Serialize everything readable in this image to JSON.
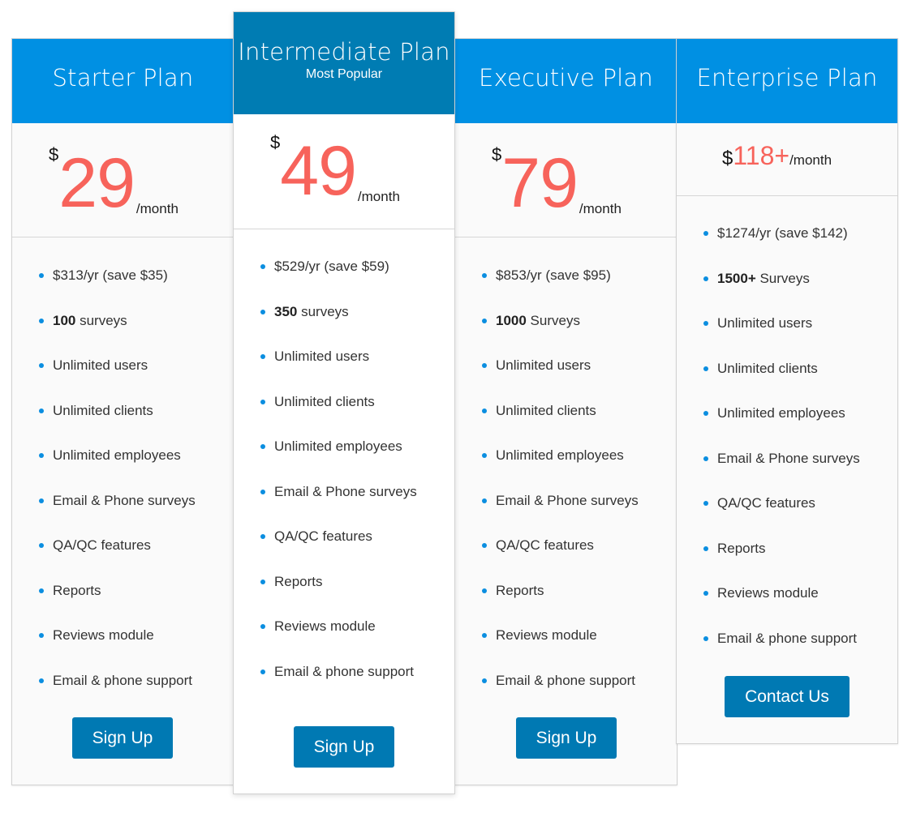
{
  "colors": {
    "header_default": "#0090e3",
    "header_popular": "#007cb3",
    "price_accent": "#f7635b",
    "button": "#0079b3",
    "bullet": "#0b8ee0"
  },
  "plans": [
    {
      "id": "starter",
      "title": "Starter Plan",
      "subtitle": "",
      "currency": "$",
      "amount": "29",
      "period": "/month",
      "features": [
        {
          "bold": "",
          "text": "$313/yr (save $35)"
        },
        {
          "bold": "100",
          "text": " surveys"
        },
        {
          "bold": "",
          "text": "Unlimited users"
        },
        {
          "bold": "",
          "text": "Unlimited clients"
        },
        {
          "bold": "",
          "text": "Unlimited employees"
        },
        {
          "bold": "",
          "text": "Email & Phone surveys"
        },
        {
          "bold": "",
          "text": "QA/QC features"
        },
        {
          "bold": "",
          "text": "Reports"
        },
        {
          "bold": "",
          "text": "Reviews module"
        },
        {
          "bold": "",
          "text": "Email & phone support"
        }
      ],
      "button_label": "Sign Up"
    },
    {
      "id": "intermediate",
      "title": "Intermediate Plan",
      "subtitle": "Most Popular",
      "currency": "$",
      "amount": "49",
      "period": "/month",
      "features": [
        {
          "bold": "",
          "text": "$529/yr (save $59)"
        },
        {
          "bold": "350",
          "text": " surveys"
        },
        {
          "bold": "",
          "text": "Unlimited users"
        },
        {
          "bold": "",
          "text": "Unlimited clients"
        },
        {
          "bold": "",
          "text": "Unlimited employees"
        },
        {
          "bold": "",
          "text": "Email & Phone surveys"
        },
        {
          "bold": "",
          "text": "QA/QC features"
        },
        {
          "bold": "",
          "text": "Reports"
        },
        {
          "bold": "",
          "text": "Reviews module"
        },
        {
          "bold": "",
          "text": "Email & phone support"
        }
      ],
      "button_label": "Sign Up"
    },
    {
      "id": "executive",
      "title": "Executive Plan",
      "subtitle": "",
      "currency": "$",
      "amount": "79",
      "period": "/month",
      "features": [
        {
          "bold": "",
          "text": "$853/yr (save $95)"
        },
        {
          "bold": "1000",
          "text": " Surveys"
        },
        {
          "bold": "",
          "text": "Unlimited users"
        },
        {
          "bold": "",
          "text": "Unlimited clients"
        },
        {
          "bold": "",
          "text": "Unlimited employees"
        },
        {
          "bold": "",
          "text": "Email & Phone surveys"
        },
        {
          "bold": "",
          "text": "QA/QC features"
        },
        {
          "bold": "",
          "text": "Reports"
        },
        {
          "bold": "",
          "text": "Reviews module"
        },
        {
          "bold": "",
          "text": "Email & phone support"
        }
      ],
      "button_label": "Sign Up"
    },
    {
      "id": "enterprise",
      "title": "Enterprise Plan",
      "subtitle": "",
      "currency": "$",
      "amount": "118+",
      "period": "/month",
      "features": [
        {
          "bold": "",
          "text": "$1274/yr (save $142)"
        },
        {
          "bold": "1500+",
          "text": " Surveys"
        },
        {
          "bold": "",
          "text": "Unlimited users"
        },
        {
          "bold": "",
          "text": "Unlimited clients"
        },
        {
          "bold": "",
          "text": "Unlimited employees"
        },
        {
          "bold": "",
          "text": "Email & Phone surveys"
        },
        {
          "bold": "",
          "text": "QA/QC features"
        },
        {
          "bold": "",
          "text": "Reports"
        },
        {
          "bold": "",
          "text": "Reviews module"
        },
        {
          "bold": "",
          "text": "Email & phone support"
        }
      ],
      "button_label": "Contact Us"
    }
  ]
}
